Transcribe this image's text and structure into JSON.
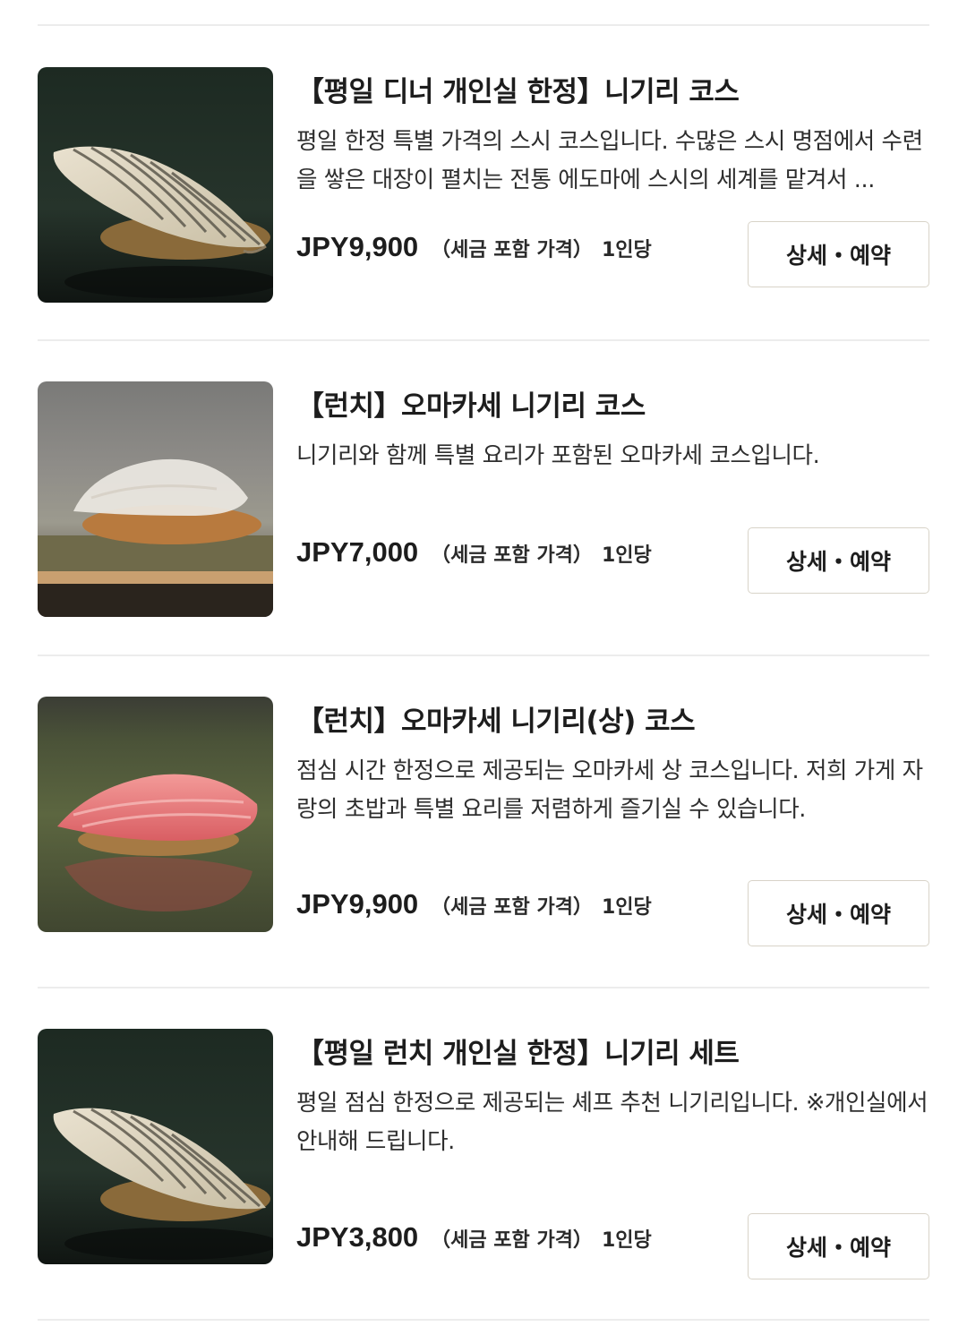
{
  "courses": [
    {
      "title": "【평일 디너 개인실 한정】니기리 코스",
      "description": "평일 한정 특별 가격의 스시 코스입니다. 수많은 스시 명점에서 수련을 쌓은 대장이 펼치는 전통 에도마에 스시의 세계를 맡겨서 ...",
      "price": "JPY9,900",
      "tax_note": "（세금 포함 가격）",
      "per_person": "1인당",
      "button_label": "상세・예약",
      "image": "striped-fish-nigiri"
    },
    {
      "title": "【런치】오마카세 니기리 코스",
      "description": "니기리와 함께 특별 요리가 포함된 오마카세 코스입니다.",
      "price": "JPY7,000",
      "tax_note": "（세금 포함 가격）",
      "per_person": "1인당",
      "button_label": "상세・예약",
      "image": "white-fish-nigiri"
    },
    {
      "title": "【런치】오마카세 니기리(상) 코스",
      "description": "점심 시간 한정으로 제공되는 오마카세 상 코스입니다. 저희 가게 자랑의 초밥과 특별 요리를 저렴하게 즐기실 수 있습니다.",
      "price": "JPY9,900",
      "tax_note": "（세금 포함 가격）",
      "per_person": "1인당",
      "button_label": "상세・예약",
      "image": "tuna-nigiri"
    },
    {
      "title": "【평일 런치 개인실 한정】니기리 세트",
      "description": "평일 점심 한정으로 제공되는 셰프 추천 니기리입니다. ※개인실에서 안내해 드립니다.",
      "price": "JPY3,800",
      "tax_note": "（세금 포함 가격）",
      "per_person": "1인당",
      "button_label": "상세・예약",
      "image": "striped-fish-nigiri"
    }
  ]
}
